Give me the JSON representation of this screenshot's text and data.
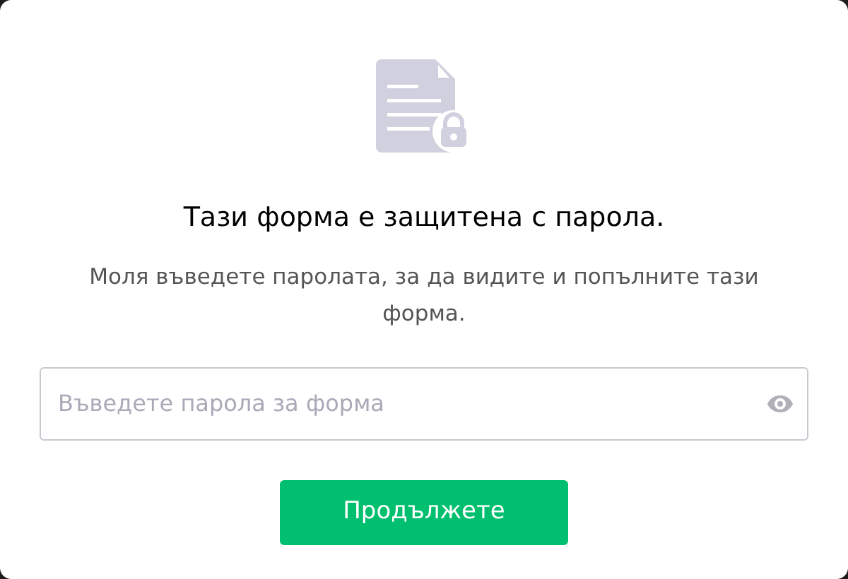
{
  "title": "Тази форма е защитена с парола.",
  "subtitle": "Моля въведете паролата, за да видите и попълните тази форма.",
  "password_field": {
    "placeholder": "Въведете парола за форма"
  },
  "submit_button": "Продължете"
}
